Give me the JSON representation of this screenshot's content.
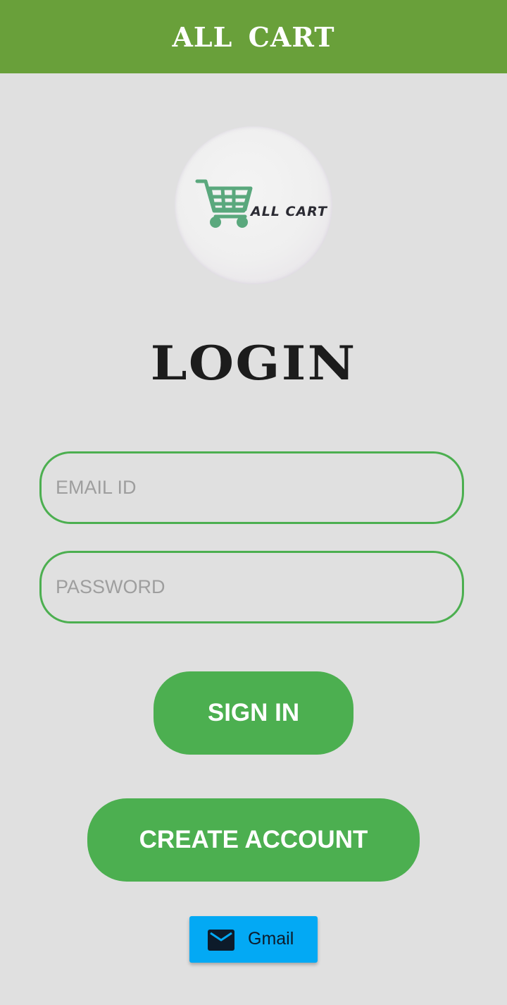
{
  "app": {
    "title": "ALL CART"
  },
  "logo": {
    "text": "ALL CART",
    "icon": "shopping-cart-icon",
    "icon_color": "#5aa87d"
  },
  "login": {
    "heading": "LOGIN"
  },
  "form": {
    "email_placeholder": "EMAIL ID",
    "password_placeholder": "PASSWORD"
  },
  "buttons": {
    "sign_in": "SIGN IN",
    "create_account": "CREATE ACCOUNT",
    "gmail": "Gmail",
    "gmail_icon": "mail-icon"
  },
  "colors": {
    "topbar": "#69a03a",
    "accent": "#4caf50",
    "gmail": "#03a9f4",
    "background": "#e0e0e0"
  }
}
